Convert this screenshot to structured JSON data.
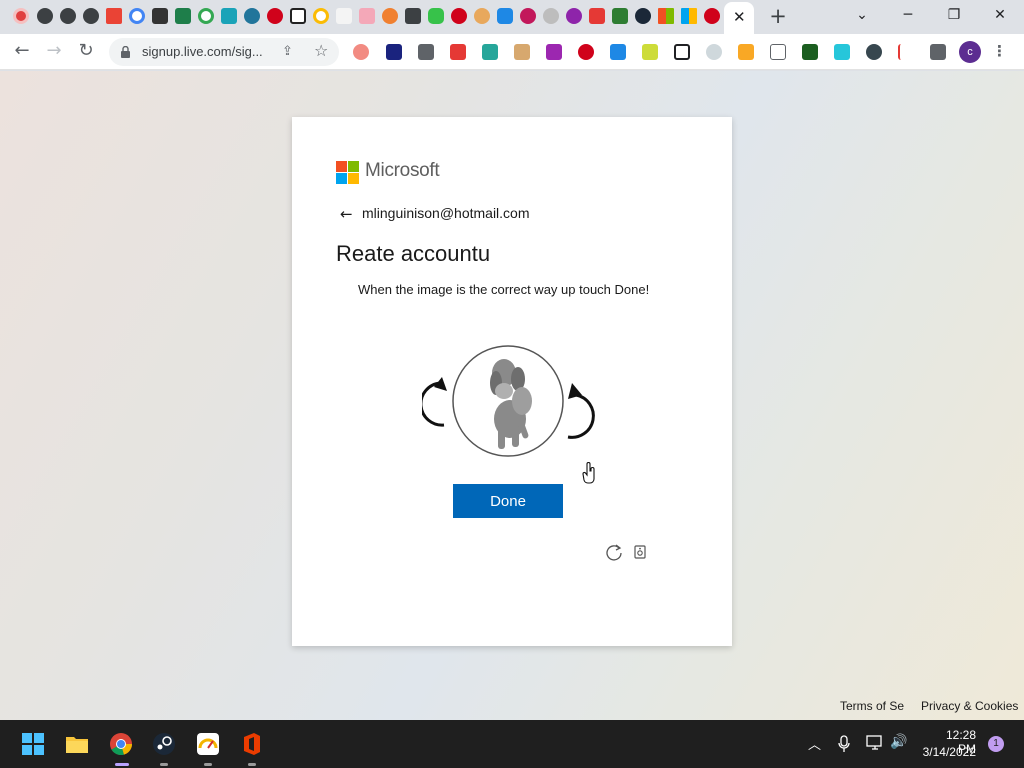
{
  "browser": {
    "tabs": {
      "favicons": [
        "red-record-icon",
        "globe-icon",
        "globe-icon",
        "globe-icon",
        "gmail-icon",
        "google-icon",
        "site-icon",
        "shield-icon",
        "google-icon",
        "site-icon",
        "wordpress-icon",
        "ask-icon",
        "amazon-icon",
        "google-icon",
        "r-icon",
        "flag-icon",
        "site-icon",
        "puzzle-icon",
        "chat-icon",
        "ask-icon",
        "smiley-icon",
        "plus-icon",
        "site-icon",
        "site-icon",
        "site-icon",
        "site-icon",
        "steam-icon",
        "windows-icon",
        "ask-icon"
      ],
      "active_tab_close": "✕",
      "new_tab": "+"
    },
    "window_controls": {
      "dropdown": "⌄",
      "minimize": "─",
      "restore": "❐",
      "close": "✕"
    },
    "toolbar": {
      "back": "←",
      "forward": "→",
      "reload": "↻",
      "url": "signup.live.com/sig...",
      "profile_initial": "c",
      "menu": "⋮"
    },
    "extensions": [
      "ext-1",
      "ext-2",
      "ext-3",
      "ext-4",
      "ext-5",
      "ext-6",
      "ext-7",
      "ext-8",
      "ext-9",
      "ext-10",
      "ext-11",
      "ext-12",
      "ext-13",
      "ext-14",
      "ext-15",
      "ext-16",
      "ext-17",
      "ext-18",
      "ext-19",
      "ext-20",
      "ext-21",
      "ext-22"
    ]
  },
  "page": {
    "brand": "Microsoft",
    "brand_colors": [
      "#f25022",
      "#7fba00",
      "#00a4ef",
      "#ffb900"
    ],
    "back_arrow": "←",
    "email": "mlinguinison@hotmail.com",
    "heading": "Reate accountu",
    "instruction": "When the image is the correct way up touch Done!",
    "done_button": "Done",
    "accent_color": "#0067b8",
    "footer": {
      "terms": "Terms of Se",
      "privacy": "Privacy & Cookies"
    }
  },
  "taskbar": {
    "apps": [
      "windows-start-icon",
      "file-explorer-icon",
      "chrome-icon",
      "steam-icon",
      "speedometer-icon",
      "office-icon"
    ],
    "tray": {
      "chevron": "︿",
      "volume": "🔊"
    },
    "time": "12:28 PM",
    "date": "3/14/2022",
    "notification_count": "1"
  }
}
